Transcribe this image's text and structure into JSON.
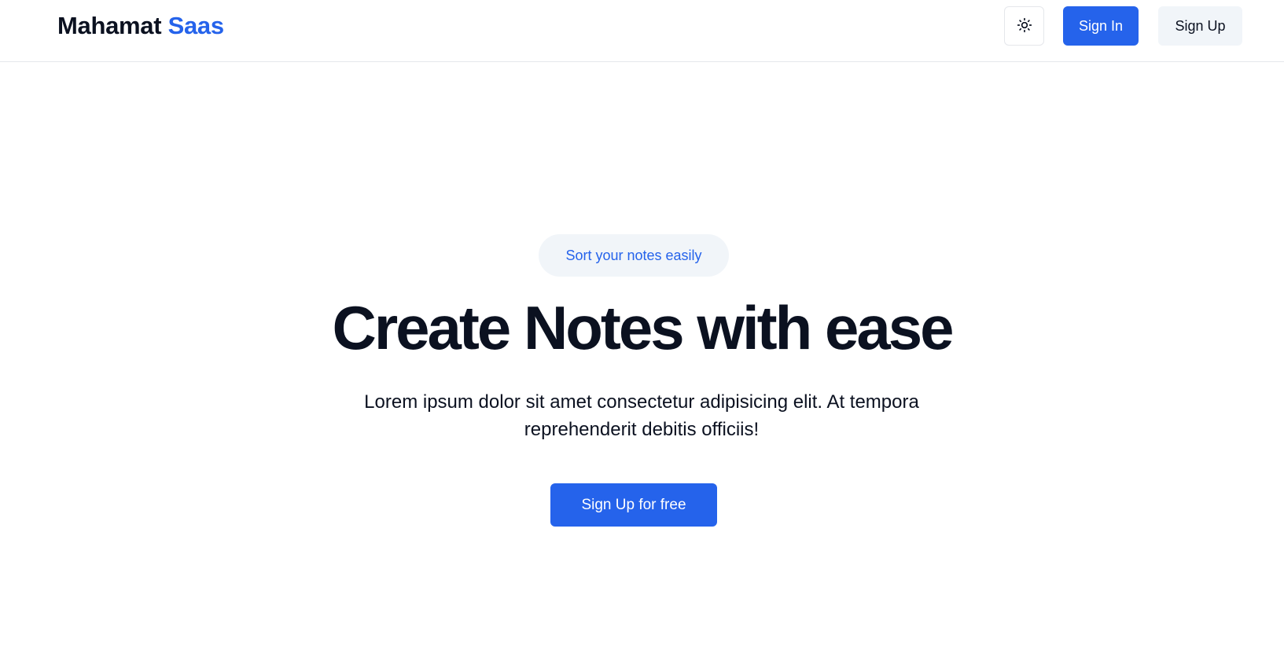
{
  "brand": {
    "name": "Mahamat",
    "accent": "Saas",
    "accent_color": "#2563eb"
  },
  "nav": {
    "theme_toggle_icon": "sun-icon",
    "sign_in_label": "Sign In",
    "sign_up_label": "Sign Up"
  },
  "hero": {
    "badge": "Sort your notes easily",
    "title": "Create Notes with ease",
    "description": "Lorem ipsum dolor sit amet consectetur adipisicing elit. At tempora reprehenderit debitis officiis!",
    "cta_label": "Sign Up for free"
  },
  "colors": {
    "primary": "#2563eb",
    "text": "#0b1120",
    "muted_bg": "#f1f5f9",
    "border": "#e5e7eb"
  }
}
